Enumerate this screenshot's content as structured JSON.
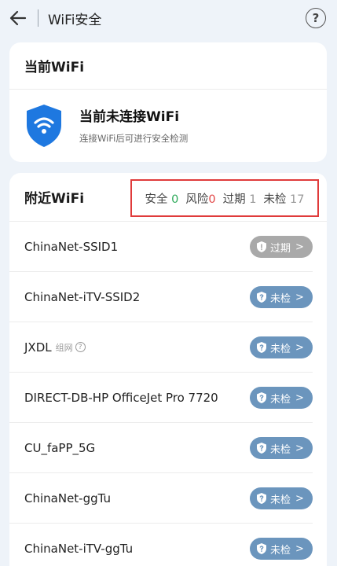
{
  "header": {
    "title": "WiFi安全",
    "help_symbol": "?"
  },
  "current": {
    "section_title": "当前WiFi",
    "status_title": "当前未连接WiFi",
    "status_subtitle": "连接WiFi后可进行安全检测",
    "shield_color": "#1e78e0"
  },
  "nearby": {
    "section_title": "附近WiFi",
    "summary": {
      "safe_label": "安全",
      "safe_count": "0",
      "risk_label": "风险",
      "risk_count": "0",
      "expired_label": "过期",
      "expired_count": "1",
      "unchecked_label": "未检",
      "unchecked_count": "17"
    },
    "networks": [
      {
        "name": "ChinaNet-SSID1",
        "tag": "",
        "status": "过期"
      },
      {
        "name": "ChinaNet-iTV-SSID2",
        "tag": "",
        "status": "未检"
      },
      {
        "name": "JXDL",
        "tag": "组网",
        "status": "未检"
      },
      {
        "name": "DIRECT-DB-HP OfficeJet Pro 7720",
        "tag": "",
        "status": "未检"
      },
      {
        "name": "CU_faPP_5G",
        "tag": "",
        "status": "未检"
      },
      {
        "name": "ChinaNet-ggTu",
        "tag": "",
        "status": "未检"
      },
      {
        "name": "ChinaNet-iTV-ggTu",
        "tag": "",
        "status": "未检"
      }
    ]
  },
  "colors": {
    "safe": "#2eaa5a",
    "risk": "#e24545",
    "expired_badge": "#a9a9a9",
    "unchecked_badge": "#6b95bd",
    "highlight_box": "#e03b3b"
  }
}
